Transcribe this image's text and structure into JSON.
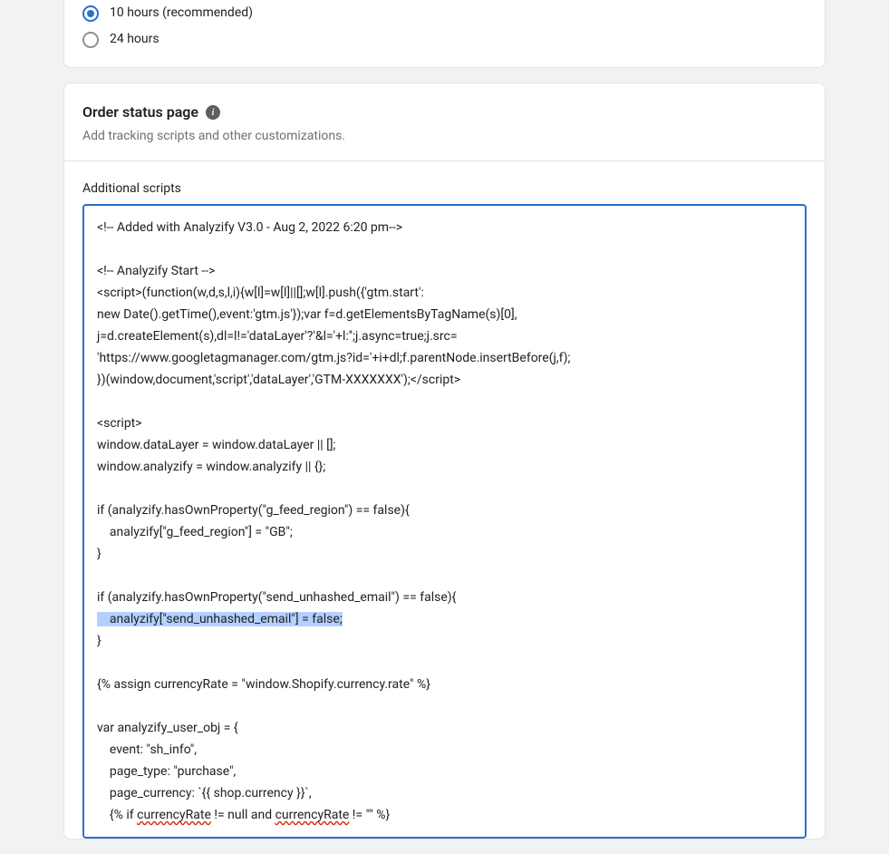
{
  "abandoned": {
    "options": [
      {
        "label": "10 hours (recommended)",
        "selected": true
      },
      {
        "label": "24 hours",
        "selected": false
      }
    ]
  },
  "orderStatus": {
    "title": "Order status page",
    "subtitle": "Add tracking scripts and other customizations.",
    "scriptsLabel": "Additional scripts",
    "codeLines": {
      "l0": "<!-- Added with Analyzify V3.0 - Aug 2, 2022 6:20 pm-->",
      "l1": "",
      "l2": "<!-- Analyzify Start -->",
      "l3": "<script>(function(w,d,s,l,i){w[l]=w[l]||[];w[l].push({'gtm.start':",
      "l4": "new Date().getTime(),event:'gtm.js'});var f=d.getElementsByTagName(s)[0],",
      "l5": "j=d.createElement(s),dl=l!='dataLayer'?'&l='+l:'';j.async=true;j.src=",
      "l6": "'https://www.googletagmanager.com/gtm.js?id='+i+dl;f.parentNode.insertBefore(j,f);",
      "l7": "})(window,document,'script','dataLayer','GTM-XXXXXXX');</script>",
      "l8": "",
      "l9": "<script>",
      "l10": "window.dataLayer = window.dataLayer || [];",
      "l11": "window.analyzify = window.analyzify || {};",
      "l12": "",
      "l13": "if (analyzify.hasOwnProperty(\"g_feed_region\") == false){",
      "l14": "    analyzify[\"g_feed_region\"] = \"GB\";",
      "l15": "}",
      "l16": "",
      "l17": "if (analyzify.hasOwnProperty(\"send_unhashed_email\") == false){",
      "l18a": "    analyzify[\"send_unhashed_email\"] = false;",
      "l19": "}",
      "l20": "",
      "l21": "{% assign currencyRate = \"window.Shopify.currency.rate\" %}",
      "l22": "",
      "l23": "var analyzify_user_obj = {",
      "l24": "    event: \"sh_info\",",
      "l25": "    page_type: \"purchase\",",
      "l26": "    page_currency: `{{ shop.currency }}`,",
      "l27a": "    {% if ",
      "l27b": "currencyRate",
      "l27c": " != null and ",
      "l27d": "currencyRate",
      "l27e": " != \"\" %}"
    }
  }
}
